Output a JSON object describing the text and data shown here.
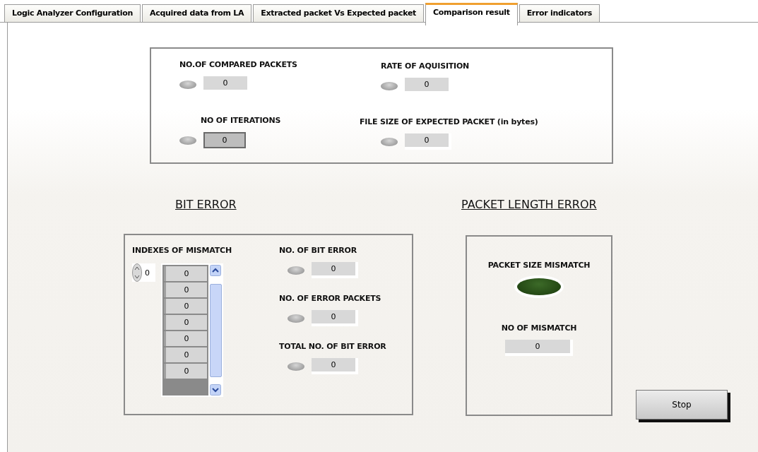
{
  "tabs": [
    {
      "label": "Logic Analyzer Configuration",
      "selected": false
    },
    {
      "label": "Acquired data from LA",
      "selected": false
    },
    {
      "label": "Extracted packet Vs Expected packet",
      "selected": false
    },
    {
      "label": "Comparison result",
      "selected": true
    },
    {
      "label": "Error indicators",
      "selected": false
    }
  ],
  "summary": [
    {
      "label": "NO.OF COMPARED PACKETS",
      "value": "0"
    },
    {
      "label": "RATE OF AQUISITION",
      "value": "0"
    },
    {
      "label": "NO OF ITERATIONS",
      "value": "0"
    },
    {
      "label": "FILE SIZE OF EXPECTED PACKET (in bytes)",
      "value": "0"
    }
  ],
  "bit_error": {
    "title": "BIT ERROR",
    "indexes_label": "INDEXES OF MISMATCH",
    "index": "0",
    "indexes": [
      "0",
      "0",
      "0",
      "0",
      "0",
      "0",
      "0"
    ],
    "counters": [
      {
        "label": "NO. OF BIT ERROR",
        "value": "0"
      },
      {
        "label": "NO. OF ERROR PACKETS",
        "value": "0"
      },
      {
        "label": "TOTAL NO. OF BIT ERROR",
        "value": "0"
      }
    ]
  },
  "packet_length_error": {
    "title": "PACKET LENGTH ERROR",
    "mismatch_label": "PACKET SIZE MISMATCH",
    "mismatch_on": false,
    "count_label": "NO OF MISMATCH",
    "count": "0"
  },
  "stop_button": "Stop"
}
